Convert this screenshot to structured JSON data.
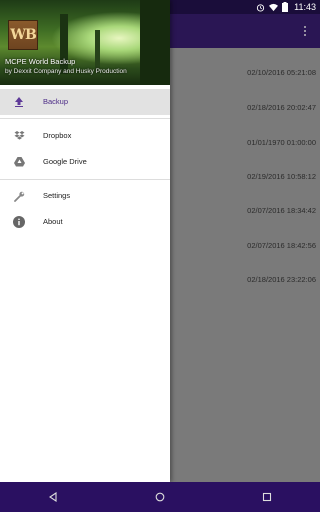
{
  "status_bar": {
    "time": "11:43"
  },
  "app": {
    "title": "MCPE World Backup",
    "subtitle": "by Dexxit Company and Husky Production",
    "logo_text": "WB"
  },
  "drawer": {
    "items": [
      {
        "label": "Backup",
        "icon": "upload-icon",
        "selected": true
      },
      {
        "label": "Dropbox",
        "icon": "dropbox-icon"
      },
      {
        "label": "Google Drive",
        "icon": "google-drive-icon"
      },
      {
        "label": "Settings",
        "icon": "wrench-icon"
      },
      {
        "label": "About",
        "icon": "info-icon"
      }
    ]
  },
  "backups": [
    "02/10/2016 05:21:08",
    "02/18/2016 20:02:47",
    "01/01/1970 01:00:00",
    "02/19/2016 10:58:12",
    "02/07/2016 18:34:42",
    "02/07/2016 18:42:56",
    "02/18/2016 23:22:06"
  ],
  "colors": {
    "status_bar": "#1a0d3a",
    "app_bar": "#2a1654",
    "nav_bar": "#2a1061",
    "accent": "#4b2a86"
  }
}
